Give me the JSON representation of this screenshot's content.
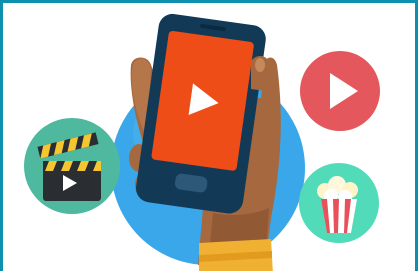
{
  "illustration": {
    "subject": "phone-video-streaming",
    "icons": [
      "play-icon",
      "clapperboard-icon",
      "popcorn-icon"
    ],
    "colors": {
      "border": "#0d8fae",
      "backdrop": "#3aa7ea",
      "phone_body": "#123a57",
      "screen": "#ef4d18",
      "hand": "#a6683e",
      "sleeve": "#f0b132",
      "play_badge": "#e4575c",
      "clapper_badge": "#4fb9a0",
      "popcorn_badge": "#52dbb8"
    }
  }
}
